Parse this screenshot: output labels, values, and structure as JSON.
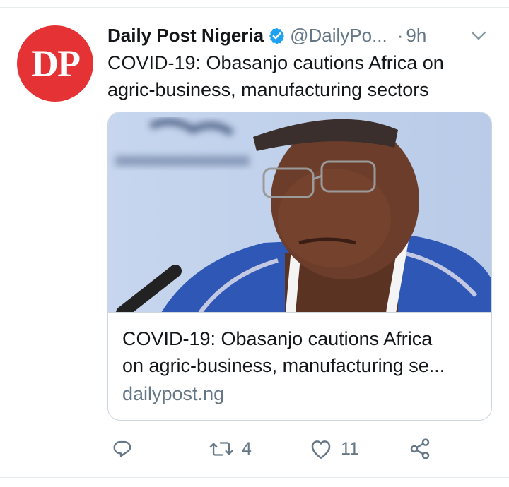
{
  "tweet": {
    "author": {
      "name": "Daily Post Nigeria",
      "handle": "@DailyPo...",
      "avatar_initials": "DP",
      "avatar_color": "#e53335",
      "verified_icon": "verified-badge-icon"
    },
    "separator": "·",
    "time": "9h",
    "menu_icon": "chevron-down-icon",
    "text": "COVID-19: Obasanjo cautions Africa on agric-business, manufacturing sectors",
    "card": {
      "title_line1": "COVID-19: Obasanjo cautions Africa",
      "title_line2": "on agric-business, manufacturing se...",
      "domain": "dailypost.ng"
    },
    "actions": {
      "reply": {
        "icon": "reply-icon"
      },
      "retweet": {
        "icon": "retweet-icon",
        "count": "4"
      },
      "like": {
        "icon": "heart-icon",
        "count": "11"
      },
      "share": {
        "icon": "share-icon"
      }
    }
  },
  "colors": {
    "verified": "#1da1f2",
    "secondary_text": "#657786",
    "primary_text": "#14171a",
    "divider": "#e6ecf0"
  }
}
